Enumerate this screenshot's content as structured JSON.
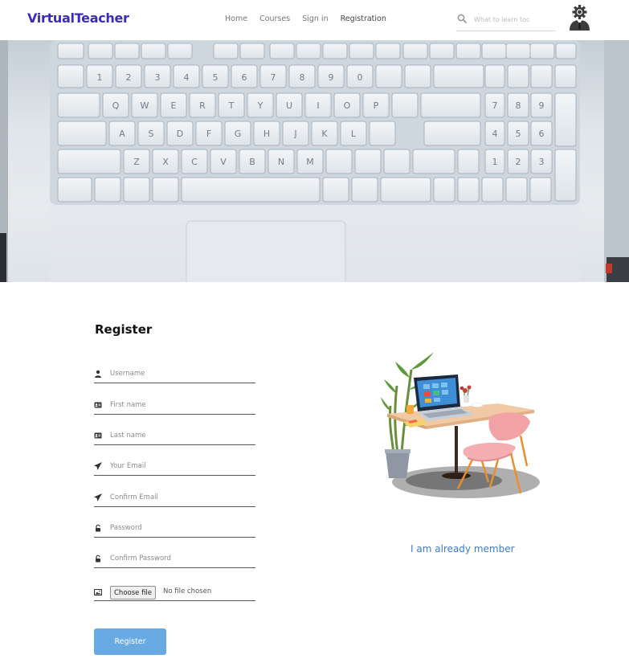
{
  "navbar": {
    "brand": "VirtualTeacher",
    "links": [
      {
        "label": "Home"
      },
      {
        "label": "Courses"
      },
      {
        "label": "Sign in"
      },
      {
        "label": "Registration"
      }
    ],
    "search": {
      "placeholder": "What to learn toc"
    },
    "avatar_icon": "user-settings-icon"
  },
  "hero": {
    "image": "laptop-keyboard-photo"
  },
  "form": {
    "title": "Register",
    "fields": [
      {
        "placeholder": "Username",
        "icon": "user-icon"
      },
      {
        "placeholder": "First name",
        "icon": "id-card-icon"
      },
      {
        "placeholder": "Last name",
        "icon": "id-card-icon"
      },
      {
        "placeholder": "Your Email",
        "icon": "paper-plane-icon"
      },
      {
        "placeholder": "Confirm Email",
        "icon": "paper-plane-icon"
      },
      {
        "placeholder": "Password",
        "icon": "lock-icon"
      },
      {
        "placeholder": "Confirm Password",
        "icon": "lock-icon"
      }
    ],
    "file": {
      "button_label": "Choose file",
      "status": "No file chosen",
      "icon": "image-icon"
    },
    "submit_label": "Register"
  },
  "side": {
    "illustration": "desk-with-laptop-illustration",
    "member_link": "I am already member"
  },
  "colors": {
    "brand": "#3a2bb8",
    "button": "#6aaae4",
    "link": "#3b7cc4"
  }
}
